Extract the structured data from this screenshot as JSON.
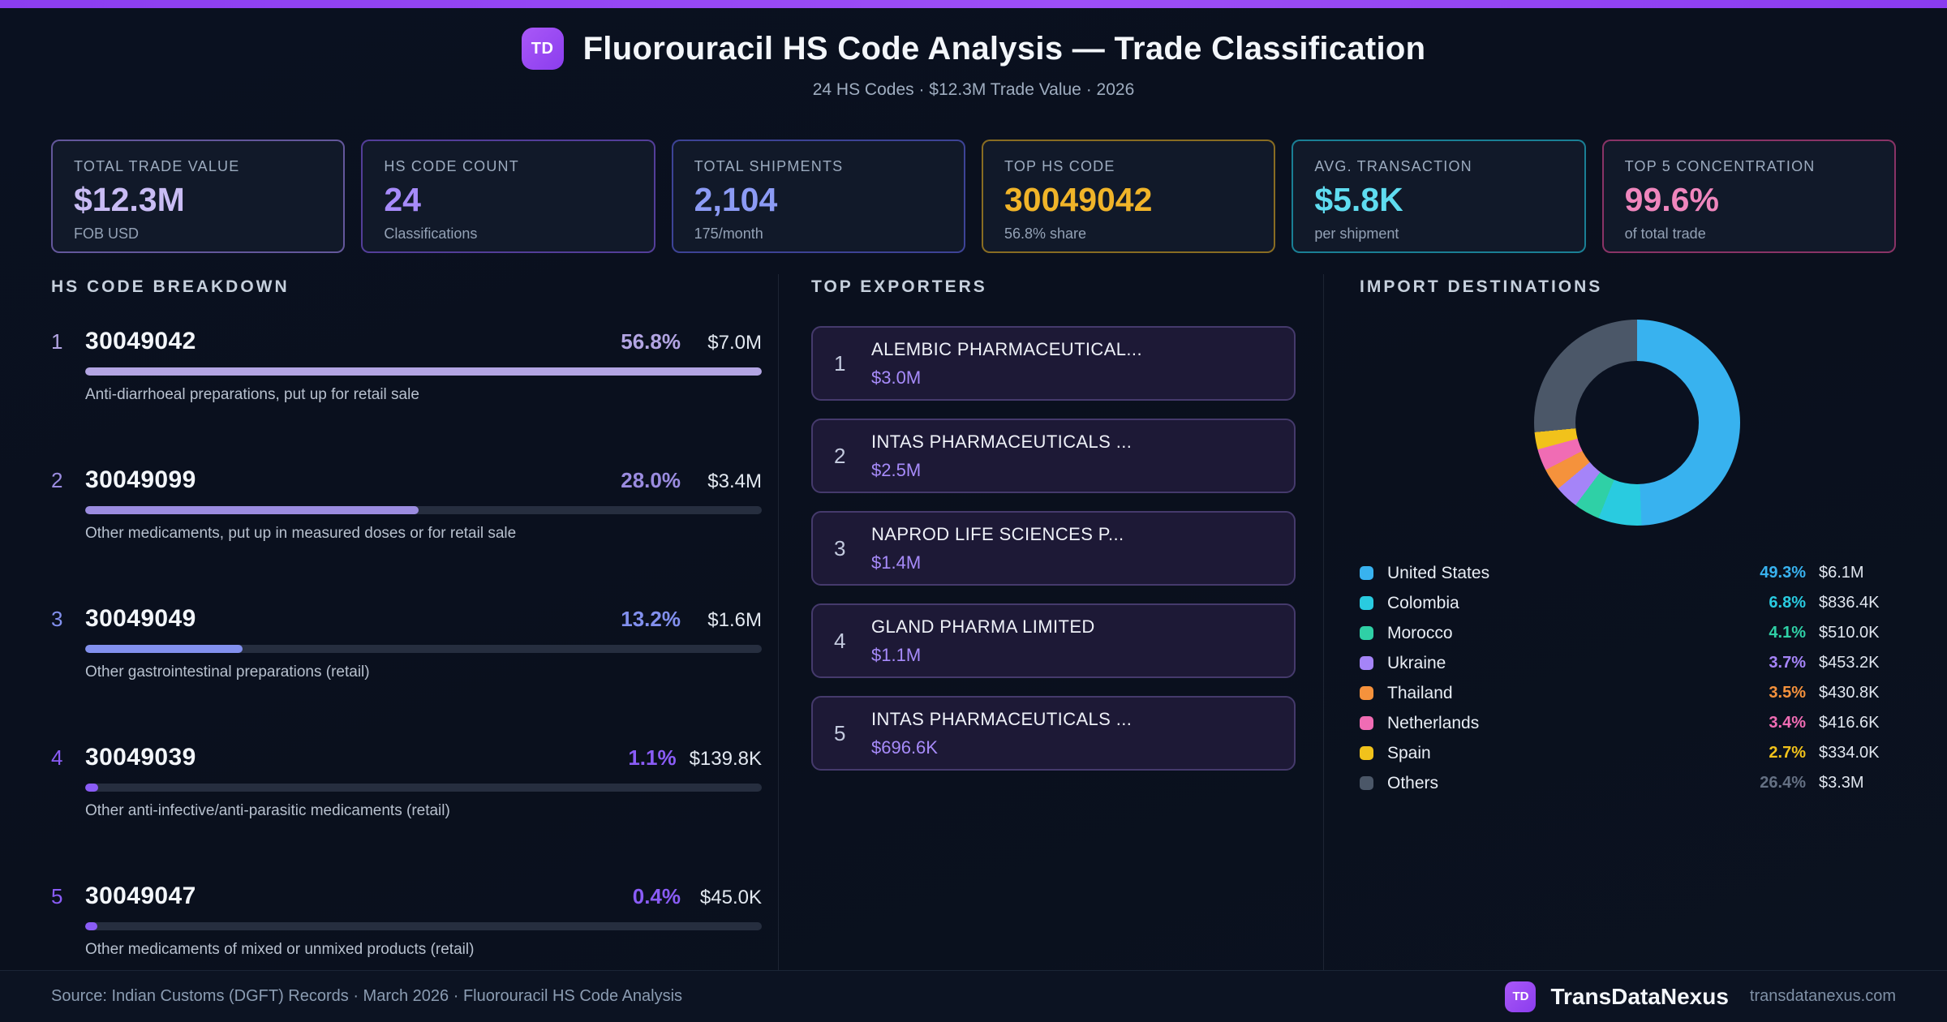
{
  "header": {
    "badge": "TD",
    "title": "Fluorouracil HS Code Analysis — Trade Classification",
    "subtitle": "24 HS Codes · $12.3M Trade Value · 2026"
  },
  "stats": [
    {
      "label": "TOTAL TRADE VALUE",
      "value": "$12.3M",
      "sub": "FOB USD",
      "color": "#c9bcf4",
      "border": "rgba(167,139,250,0.55)"
    },
    {
      "label": "HS CODE COUNT",
      "value": "24",
      "sub": "Classifications",
      "color": "#a78bfa",
      "border": "rgba(139,92,246,0.55)"
    },
    {
      "label": "TOTAL SHIPMENTS",
      "value": "2,104",
      "sub": "175/month",
      "color": "#8c9bf5",
      "border": "rgba(99,102,241,0.55)"
    },
    {
      "label": "TOP HS CODE",
      "value": "30049042",
      "sub": "56.8% share",
      "color": "#f0b429",
      "border": "rgba(217,164,32,0.6)"
    },
    {
      "label": "AVG. TRANSACTION",
      "value": "$5.8K",
      "sub": "per shipment",
      "color": "#5fdcf0",
      "border": "rgba(34,211,238,0.55)"
    },
    {
      "label": "TOP 5 CONCENTRATION",
      "value": "99.6%",
      "sub": "of total trade",
      "color": "#ef86bd",
      "border": "rgba(236,72,153,0.55)"
    }
  ],
  "breakdown": {
    "heading": "HS CODE BREAKDOWN",
    "max_percent": 56.8,
    "rows": [
      {
        "rank": "1",
        "code": "30049042",
        "percent": "56.8%",
        "pct": 56.8,
        "value": "$7.0M",
        "desc": "Anti-diarrhoeal preparations, put up for retail sale",
        "color": "#b3a5e3"
      },
      {
        "rank": "2",
        "code": "30049099",
        "percent": "28.0%",
        "pct": 28.0,
        "value": "$3.4M",
        "desc": "Other medicaments, put up in measured doses or for retail sale",
        "color": "#9b8ce0"
      },
      {
        "rank": "3",
        "code": "30049049",
        "percent": "13.2%",
        "pct": 13.2,
        "value": "$1.6M",
        "desc": "Other gastrointestinal preparations (retail)",
        "color": "#8290ee"
      },
      {
        "rank": "4",
        "code": "30049039",
        "percent": "1.1%",
        "pct": 1.1,
        "value": "$139.8K",
        "desc": "Other anti-infective/anti-parasitic medicaments (retail)",
        "color": "#8a5cf6"
      },
      {
        "rank": "5",
        "code": "30049047",
        "percent": "0.4%",
        "pct": 0.4,
        "value": "$45.0K",
        "desc": "Other medicaments of mixed or unmixed products (retail)",
        "color": "#8a5cf6"
      }
    ]
  },
  "exporters": {
    "heading": "TOP EXPORTERS",
    "items": [
      {
        "rank": "1",
        "name": "ALEMBIC PHARMACEUTICAL...",
        "value": "$3.0M"
      },
      {
        "rank": "2",
        "name": "INTAS PHARMACEUTICALS ...",
        "value": "$2.5M"
      },
      {
        "rank": "3",
        "name": "NAPROD LIFE SCIENCES P...",
        "value": "$1.4M"
      },
      {
        "rank": "4",
        "name": "GLAND PHARMA LIMITED",
        "value": "$1.1M"
      },
      {
        "rank": "5",
        "name": "INTAS PHARMACEUTICALS ...",
        "value": "$696.6K"
      }
    ]
  },
  "destinations": {
    "heading": "IMPORT DESTINATIONS"
  },
  "chart_data": {
    "type": "pie",
    "subtype": "donut",
    "title": "IMPORT DESTINATIONS",
    "legend_position": "bottom",
    "start_angle_deg": 0,
    "direction": "clockwise",
    "labels": [
      "United States",
      "Colombia",
      "Morocco",
      "Ukraine",
      "Thailand",
      "Netherlands",
      "Spain",
      "Others"
    ],
    "values": [
      49.3,
      6.8,
      4.1,
      3.7,
      3.5,
      3.4,
      2.7,
      26.4
    ],
    "percent_labels": [
      "49.3%",
      "6.8%",
      "4.1%",
      "3.7%",
      "3.5%",
      "3.4%",
      "2.7%",
      "26.4%"
    ],
    "amount_labels": [
      "$6.1M",
      "$836.4K",
      "$510.0K",
      "$453.2K",
      "$430.8K",
      "$416.6K",
      "$334.0K",
      "$3.3M"
    ],
    "colors": [
      "#38b2ef",
      "#29cbe0",
      "#2fd0a6",
      "#a584f8",
      "#f5923c",
      "#f06cb4",
      "#f1c21b",
      "#4b5768"
    ],
    "pct_text_colors": [
      "#38b2ef",
      "#29cbe0",
      "#2fd0a6",
      "#a584f8",
      "#f5923c",
      "#f06cb4",
      "#f1c21b",
      "#647083"
    ]
  },
  "footer": {
    "source": "Source: Indian Customs (DGFT) Records · March 2026 · Fluorouracil HS Code Analysis",
    "badge": "TD",
    "brand": "TransDataNexus",
    "domain": "transdatanexus.com"
  }
}
